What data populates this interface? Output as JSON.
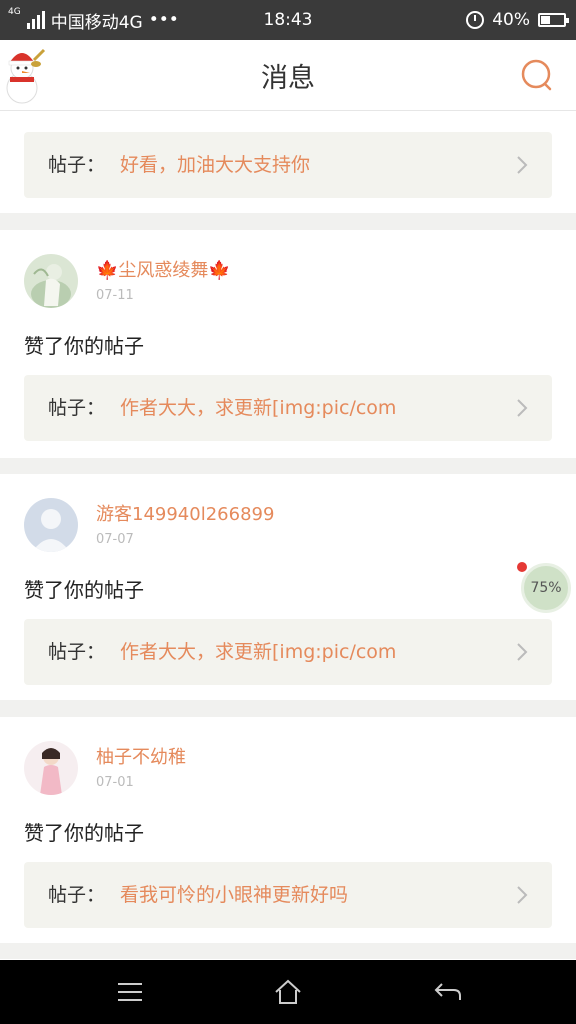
{
  "status_bar": {
    "network_small": "4G",
    "carrier": "中国移动4G",
    "dots": "•••",
    "time": "18:43",
    "battery": "40%",
    "battery_level": 0.4
  },
  "header": {
    "title": "消息",
    "search_icon": "search-icon",
    "avatar_icon": "snowman-avatar-icon"
  },
  "post_prefix": "帖子：",
  "notifications": [
    {
      "partial": true,
      "post_text": "好看，加油大大支持你"
    },
    {
      "user_name": "🍁尘风惑绫舞🍁",
      "date": "07-11",
      "action": "赞了你的帖子",
      "post_text": "作者大大，求更新[img:pic/com",
      "avatar_color": "#c9d9c0"
    },
    {
      "user_name": "游客149940l266899",
      "date": "07-07",
      "action": "赞了你的帖子",
      "post_text": "作者大大，求更新[img:pic/com",
      "avatar_color": "#d2dbe8"
    },
    {
      "user_name": "柚子不幼稚",
      "date": "07-01",
      "action": "赞了你的帖子",
      "post_text": "看我可怜的小眼神更新好吗",
      "avatar_color": "#f2d7dd"
    }
  ],
  "float_ball": {
    "label": "75%"
  },
  "nav_bar": {
    "menu_icon": "menu-icon",
    "home_icon": "home-icon",
    "back_icon": "back-icon"
  },
  "colors": {
    "accent": "#e58a5c",
    "background": "#f1f1ef"
  }
}
